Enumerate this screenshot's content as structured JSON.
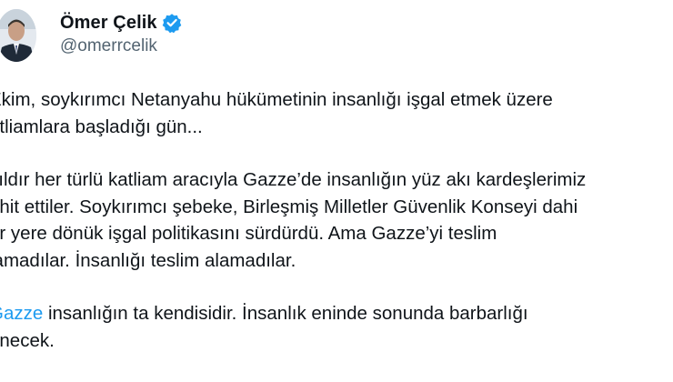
{
  "author": {
    "display_name": "Ömer Çelik",
    "handle": "@omerrcelik",
    "verified_icon": "verified-badge-icon",
    "verified_color": "#1d9bf0"
  },
  "tweet": {
    "paragraph1": [
      "Ekim, soykırımcı Netanyahu hükümetinin insanlığı işgal etmek üzere",
      "atliamlara başladığı gün..."
    ],
    "paragraph2": [
      "yıldır her türlü katliam aracıyla Gazze’de insanlığın yüz akı kardeşlerimiz",
      "ehit ettiler. Soykırımcı şebeke, Birleşmiş Milletler Güvenlik Konseyi dahi",
      "er yere dönük işgal politikasını sürdürdü. Ama Gazze’yi teslim",
      "lamadılar. İnsanlığı teslim alamadılar."
    ],
    "paragraph3": {
      "hashtag": "Gazze",
      "line1_rest": " insanlığın ta kendisidir. İnsanlık eninde sonunda barbarlığı",
      "line2": "enecek."
    }
  },
  "colors": {
    "text": "#0f1419",
    "secondary": "#536471",
    "link": "#1d9bf0"
  }
}
